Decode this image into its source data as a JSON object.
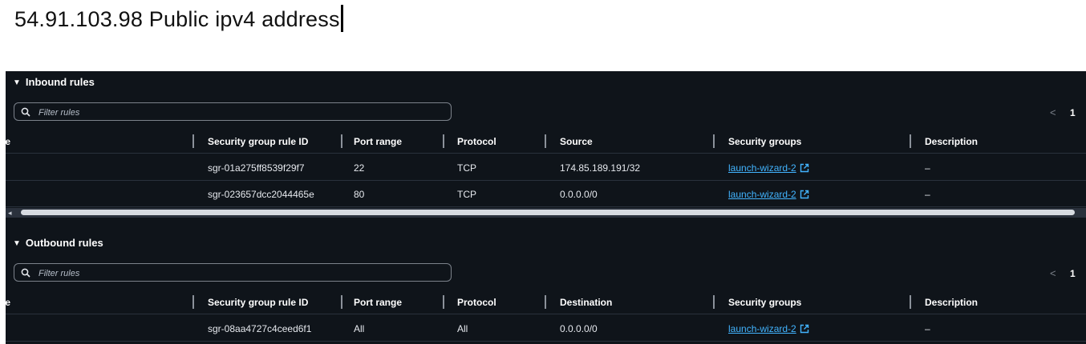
{
  "header_text": "54.91.103.98 Public ipv4 address",
  "colors": {
    "panel_bg": "#0f141a",
    "link": "#42b4ff",
    "text": "#e6e9ee"
  },
  "inbound": {
    "title": "Inbound rules",
    "filter_placeholder": "Filter rules",
    "pager_prev": "<",
    "page": "1",
    "columns": [
      "ne",
      "Security group rule ID",
      "Port range",
      "Protocol",
      "Source",
      "Security groups",
      "Description"
    ],
    "rows": [
      {
        "rule_id": "sgr-01a275ff8539f29f7",
        "port": "22",
        "protocol": "TCP",
        "source": "174.85.189.191/32",
        "group": "launch-wizard-2",
        "description": "–"
      },
      {
        "rule_id": "sgr-023657dcc2044465e",
        "port": "80",
        "protocol": "TCP",
        "source": "0.0.0.0/0",
        "group": "launch-wizard-2",
        "description": "–"
      }
    ]
  },
  "scrollbar": {
    "left_arrow": "◂"
  },
  "outbound": {
    "title": "Outbound rules",
    "filter_placeholder": "Filter rules",
    "pager_prev": "<",
    "page": "1",
    "columns": [
      "ne",
      "Security group rule ID",
      "Port range",
      "Protocol",
      "Destination",
      "Security groups",
      "Description"
    ],
    "rows": [
      {
        "rule_id": "sgr-08aa4727c4ceed6f1",
        "port": "All",
        "protocol": "All",
        "destination": "0.0.0.0/0",
        "group": "launch-wizard-2",
        "description": "–"
      }
    ]
  },
  "icons": {
    "search": "search-icon",
    "external": "external-link-icon",
    "expand": "caret-down-icon"
  }
}
